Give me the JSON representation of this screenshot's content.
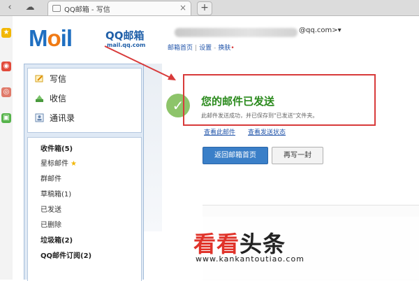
{
  "browser": {
    "tab_title": "QQ邮箱 - 写信",
    "tab_close": "×",
    "new_tab": "+"
  },
  "header": {
    "brand": "QQ邮箱",
    "domain": "mail.qq.com",
    "account_email": "@qq.com>",
    "links": [
      "邮箱首页",
      "设置",
      "换肤"
    ]
  },
  "sidebar": {
    "commands": [
      {
        "label": "写信",
        "icon": "pencil-icon"
      },
      {
        "label": "收信",
        "icon": "inbox-icon"
      },
      {
        "label": "通讯录",
        "icon": "contacts-icon"
      }
    ],
    "folders": [
      {
        "label": "收件箱(5)",
        "bold": true
      },
      {
        "label": "星标邮件",
        "star": true
      },
      {
        "label": "群邮件"
      },
      {
        "label": "草稿箱(1)"
      },
      {
        "label": "已发送"
      },
      {
        "label": "已删除"
      },
      {
        "label": "垃圾箱(2)",
        "bold": true
      },
      {
        "label": "QQ邮件订阅(2)",
        "bold": true
      }
    ]
  },
  "main": {
    "title": "您的邮件已发送",
    "description": "此邮件发送成功，并已保存到\"已发送\"文件夹。",
    "links": [
      "查看此邮件",
      "查看发送状态"
    ],
    "primary_button": "返回邮箱首页",
    "secondary_button": "再写一封"
  },
  "watermark": {
    "part1": "看看",
    "part2": "头条",
    "url": "www.kankantoutiao.com"
  },
  "colors": {
    "highlight": "#d83a3a",
    "success_title": "#2a8a1c",
    "primary": "#3a7fc8"
  }
}
